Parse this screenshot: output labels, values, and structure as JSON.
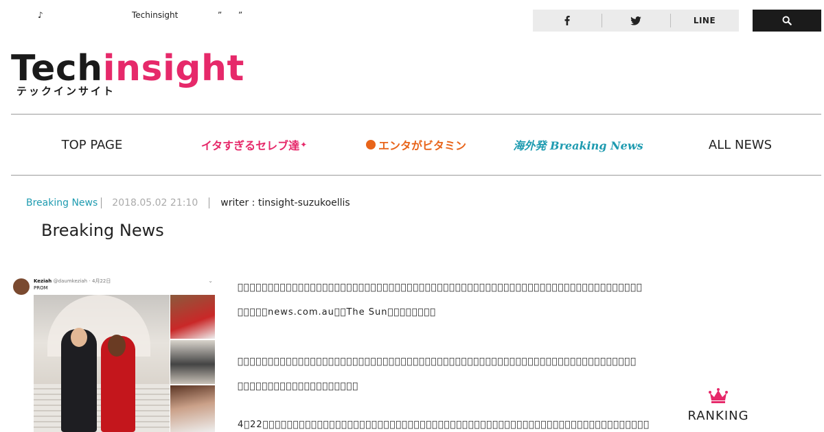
{
  "topbar": {
    "note_glyph": "♪",
    "site_name": "Techinsight",
    "quote_open": "”",
    "quote_close": "”",
    "share": [
      "facebook-icon",
      "twitter-icon"
    ],
    "share_line_label": "LINE",
    "search_icon": "search-icon",
    "share_bg": "#ebebeb",
    "search_bg": "#1b1b1b"
  },
  "logo": {
    "part1": "Tech",
    "part2": "insight",
    "kana": "テックインサイト",
    "accent": "#e6296a"
  },
  "nav": {
    "items": [
      {
        "label": "TOP PAGE"
      },
      {
        "label": "イタすぎるセレブ達"
      },
      {
        "label": "エンタがビタミン"
      },
      {
        "label": "海外発 Breaking News"
      },
      {
        "label": "ALL NEWS"
      }
    ]
  },
  "article": {
    "category": "Breaking News",
    "date": "2018.05.02 21:10",
    "writer": "writer : tinsight-suzukoellis",
    "title": "Breaking News",
    "image": {
      "name": "Keziah",
      "handle": "@daumkeziah",
      "date": "· 4月22日",
      "caption": "PROM",
      "chevron": "⌄"
    },
    "paragraphs": [
      "\u0000\u0000\u0000\u0000\u0000\u0000\u0000\u0000\u0000\u0000\u0000\u0000\u0000\u0000\u0000\u0000\u0000\u0000\u0000\u0000\u0000\u0000\u0000\u0000\u0000\u0000\u0000\u0000\u0000\u0000\u0000\u0000\u0000\u0000\u0000\u0000\u0000\u0000\u0000\u0000\u0000\u0000\u0000\u0000\u0000\u0000\u0000\u0000\u0000\u0000\u0000\u0000\u0000\u0000\u0000\u0000\u0000\u0000\u0000\u0000\u0000\u0000\u0000\u0000\u0000\u0000\u0000",
      "\u0000\u0000\u0000\u0000\u0000news.com.au\u0000\u0000The Sun\u0000\u0000\u0000\u0000\u0000\u0000\u0000\u0000",
      "\u0000\u0000\u0000\u0000\u0000\u0000\u0000\u0000\u0000\u0000\u0000\u0000\u0000\u0000\u0000\u0000\u0000\u0000\u0000\u0000\u0000\u0000\u0000\u0000\u0000\u0000\u0000\u0000\u0000\u0000\u0000\u0000\u0000\u0000\u0000\u0000\u0000\u0000\u0000\u0000\u0000\u0000\u0000\u0000\u0000\u0000\u0000\u0000\u0000\u0000\u0000\u0000\u0000\u0000\u0000\u0000\u0000\u0000\u0000\u0000\u0000\u0000\u0000\u0000\u0000\u0000",
      "\u0000\u0000\u0000\u0000\u0000\u0000\u0000\u0000\u0000\u0000\u0000\u0000\u0000\u0000\u0000\u0000\u0000\u0000\u0000\u0000",
      "4\u000022\u0000\u0000\u0000\u0000\u0000\u0000\u0000\u0000\u0000\u0000\u0000\u0000\u0000\u0000\u0000\u0000\u0000\u0000\u0000\u0000\u0000\u0000\u0000\u0000\u0000\u0000\u0000\u0000\u0000\u0000\u0000\u0000\u0000\u0000\u0000\u0000\u0000\u0000\u0000\u0000\u0000\u0000\u0000\u0000\u0000\u0000\u0000\u0000\u0000\u0000\u0000\u0000\u0000\u0000\u0000\u0000\u0000\u0000\u0000\u0000\u0000\u0000\u0000\u0000"
    ]
  },
  "ranking": {
    "label": "RANKING",
    "icon": "crown-icon",
    "color": "#e6296a"
  }
}
